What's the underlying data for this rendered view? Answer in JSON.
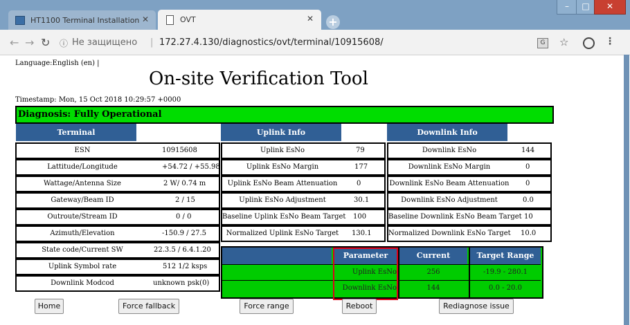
{
  "browser": {
    "tabs": [
      {
        "title": "HT1100 Terminal Installation"
      },
      {
        "title": "OVT"
      }
    ],
    "security_label": "Не защищено",
    "url": "172.27.4.130/diagnostics/ovt/terminal/10915608/"
  },
  "page": {
    "language": "Language:English (en) |",
    "title": "On-site Verification Tool",
    "timestamp": "Timestamp: Mon, 15 Oct 2018 10:29:57 +0000",
    "diagnosis": "Diagnosis: Fully Operational",
    "diagnosis_color": "#00dd00",
    "header_color": "#305f95"
  },
  "terminal": {
    "header": "Terminal",
    "rows": [
      {
        "label": "ESN",
        "value": "10915608"
      },
      {
        "label": "Lattitude/Longitude",
        "value": "+54.72 / +55.98"
      },
      {
        "label": "Wattage/Antenna Size",
        "value": "2 W/ 0.74 m"
      },
      {
        "label": "Gateway/Beam ID",
        "value": "2 / 15"
      },
      {
        "label": "Outroute/Stream ID",
        "value": "0 / 0"
      },
      {
        "label": "Azimuth/Elevation",
        "value": "-150.9 / 27.5"
      },
      {
        "label": "State code/Current SW",
        "value": "22.3.5 / 6.4.1.20"
      },
      {
        "label": "Uplink Symbol rate",
        "value": "512 1/2 ksps"
      },
      {
        "label": "Downlink Modcod",
        "value": "unknown psk(0)"
      }
    ]
  },
  "uplink": {
    "header": "Uplink Info",
    "rows": [
      {
        "label": "Uplink EsNo",
        "value": "79"
      },
      {
        "label": "Uplink EsNo Margin",
        "value": "177"
      },
      {
        "label": "Uplink EsNo Beam Attenuation",
        "value": "0"
      },
      {
        "label": "Uplink EsNo Adjustment",
        "value": "30.1"
      },
      {
        "label": "Baseline Uplink EsNo Beam Target",
        "value": "100"
      },
      {
        "label": "Normalized Uplink EsNo Target",
        "value": "130.1"
      }
    ]
  },
  "downlink": {
    "header": "Downlink Info",
    "rows": [
      {
        "label": "Downlink EsNo",
        "value": "144"
      },
      {
        "label": "Downlink EsNo Margin",
        "value": "0"
      },
      {
        "label": "Downlink EsNo Beam Attenuation",
        "value": "0"
      },
      {
        "label": "Downlink EsNo Adjustment",
        "value": "0.0"
      },
      {
        "label": "Baseline Downlink EsNo Beam Target",
        "value": "10"
      },
      {
        "label": "Normalized Downlink EsNo Target",
        "value": "10.0"
      }
    ]
  },
  "target_table": {
    "columns": [
      "Parameter",
      "Current",
      "Target Range"
    ],
    "rows": [
      {
        "parameter": "Uplink EsNo",
        "current": "256",
        "range": "-19.9 - 280.1"
      },
      {
        "parameter": "Downlink EsNo",
        "current": "144",
        "range": "0.0 - 20.0"
      }
    ],
    "row_color": "#00cc00"
  },
  "buttons": {
    "home": "Home",
    "force_fallback": "Force fallback",
    "force_range": "Force range",
    "reboot": "Reboot",
    "rediagnose": "Rediagnose issue"
  }
}
